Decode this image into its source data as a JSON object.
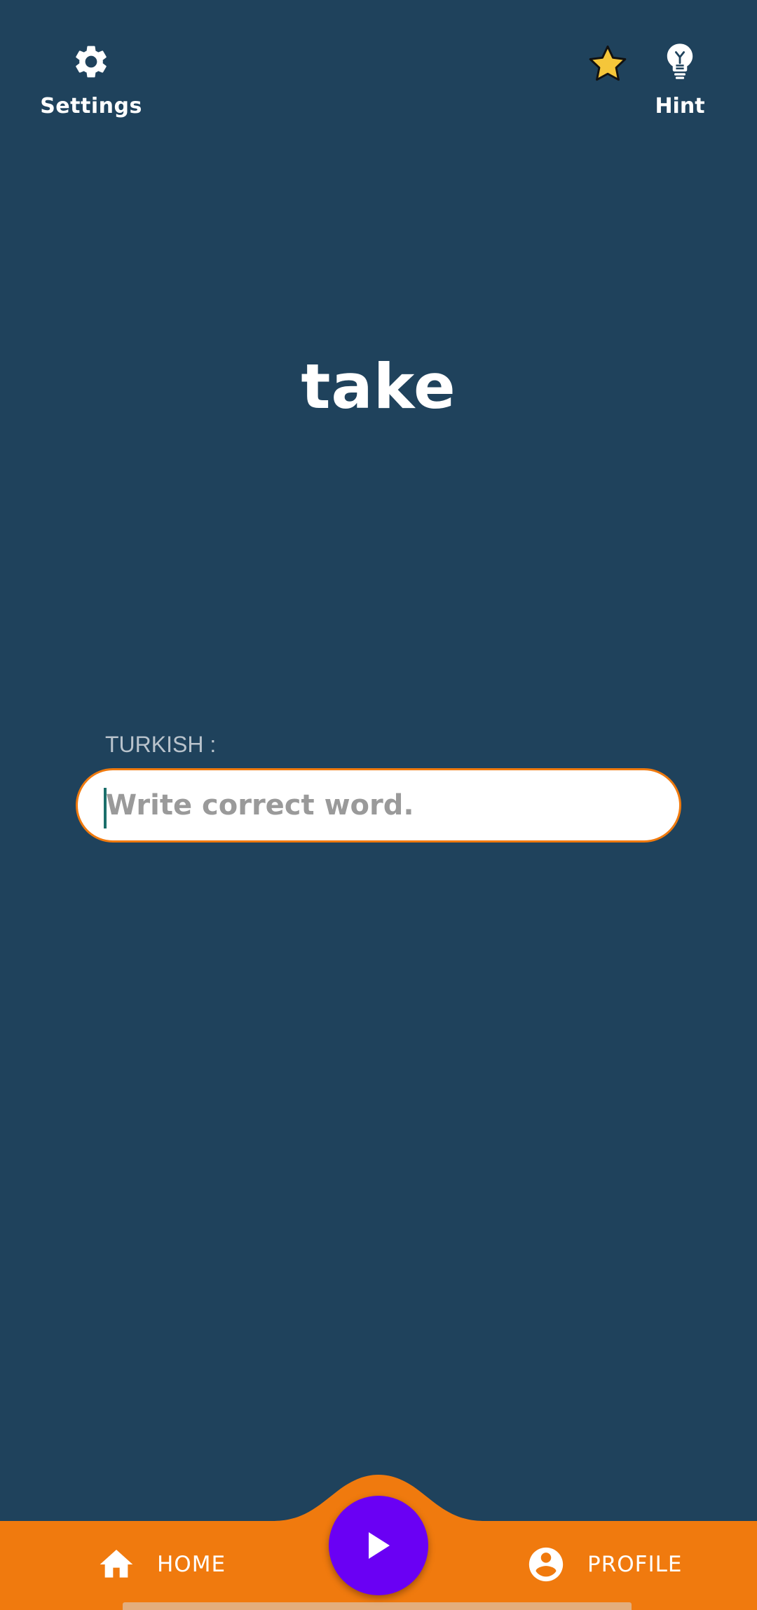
{
  "header": {
    "settings_label": "Settings",
    "hint_label": "Hint"
  },
  "quiz": {
    "word": "take",
    "language_label": "TURKISH :",
    "answer_value": "",
    "answer_placeholder": "Write correct word."
  },
  "bottom_nav": {
    "home_label": "HOME",
    "profile_label": "PROFILE",
    "play_icon": "play-icon"
  },
  "colors": {
    "background": "#1f425c",
    "accent_orange": "#f07a0e",
    "play_purple": "#6a00f4",
    "star_yellow": "#f5c63a"
  }
}
